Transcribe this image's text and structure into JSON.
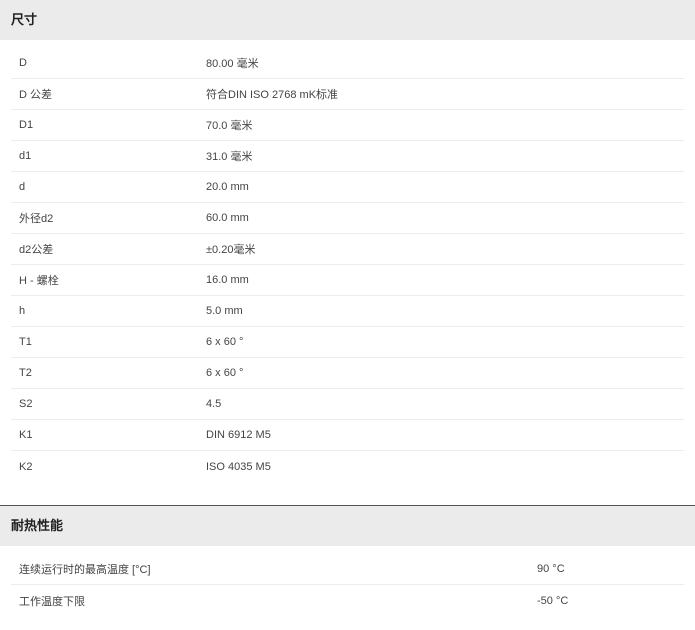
{
  "dimensions": {
    "title": "尺寸",
    "rows": [
      {
        "label": "D",
        "value": "80.00 毫米"
      },
      {
        "label": "D 公差",
        "value": "符合DIN ISO 2768 mK标准"
      },
      {
        "label": "D1",
        "value": "70.0 毫米"
      },
      {
        "label": "d1",
        "value": "31.0 毫米"
      },
      {
        "label": "d",
        "value": "20.0 mm"
      },
      {
        "label": "外径d2",
        "value": "60.0 mm"
      },
      {
        "label": "d2公差",
        "value": "±0.20毫米"
      },
      {
        "label": "H - 螺栓",
        "value": "16.0 mm"
      },
      {
        "label": "h",
        "value": "5.0 mm"
      },
      {
        "label": "T1",
        "value": "6 x 60 °"
      },
      {
        "label": "T2",
        "value": "6 x 60 °"
      },
      {
        "label": "S2",
        "value": "4.5"
      },
      {
        "label": "K1",
        "value": "DIN 6912 M5"
      },
      {
        "label": "K2",
        "value": "ISO 4035 M5"
      }
    ]
  },
  "heat_resistance": {
    "title": "耐热性能",
    "rows": [
      {
        "label": "连续运行时的最高温度 [°C]",
        "value": "90 °C"
      },
      {
        "label": "工作温度下限",
        "value": "-50 °C"
      }
    ]
  }
}
